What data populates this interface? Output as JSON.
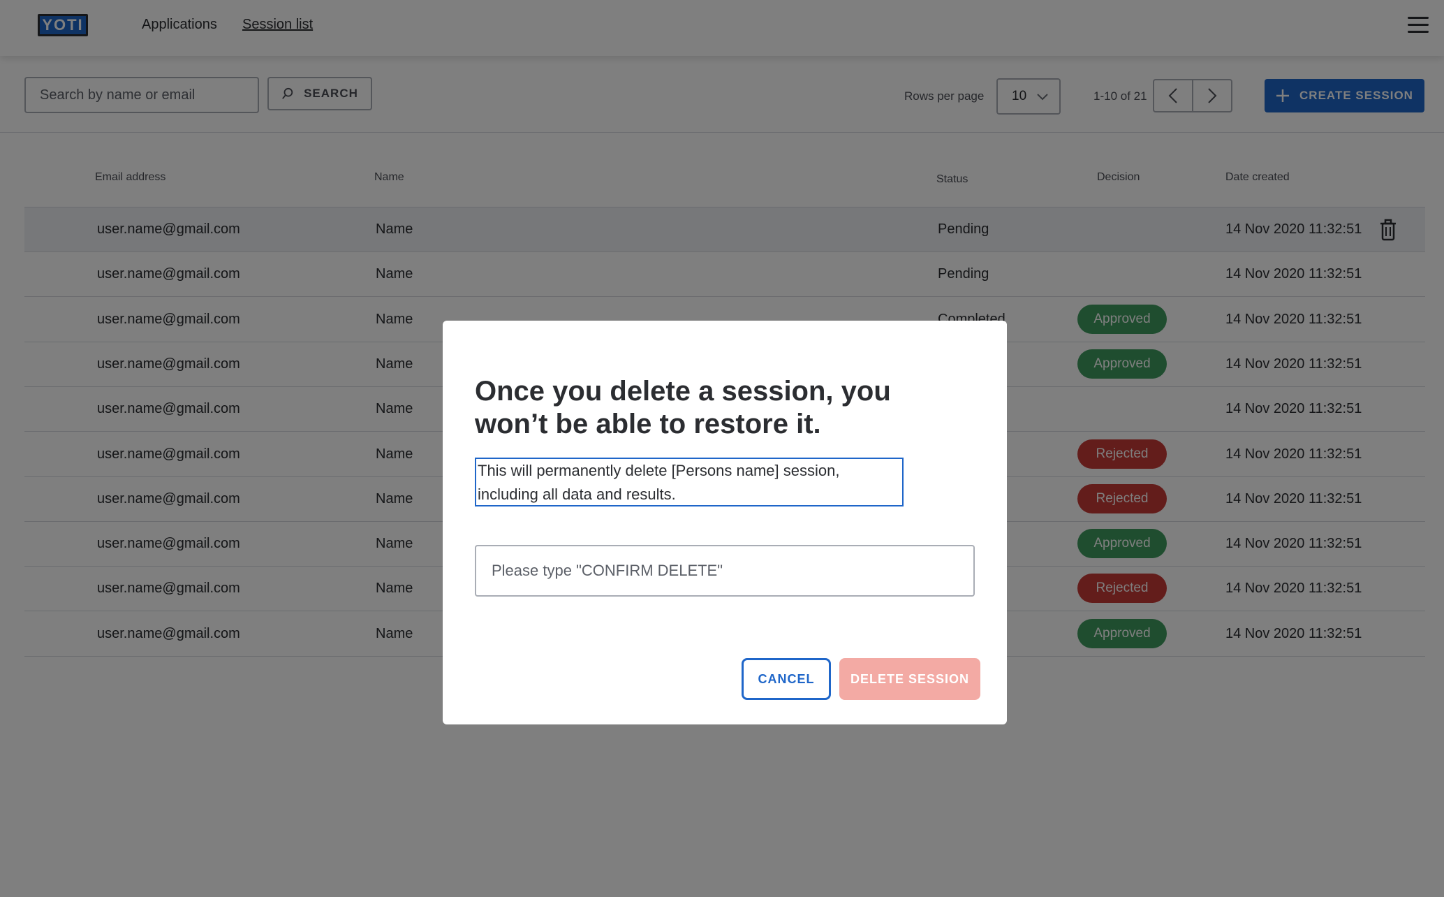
{
  "colors": {
    "brand": "#1f66c9",
    "approved": "#3f9b5e",
    "rejected": "#c73a36",
    "delete_disabled": "#f3aaa4"
  },
  "nav": {
    "logo_text": "YOTI",
    "links": [
      "Applications",
      "Session list"
    ],
    "menu_icon": "hamburger-icon"
  },
  "toolbar": {
    "search_placeholder": "Search by name or email",
    "search_label": "SEARCH",
    "rows_per_page_label": "Rows per page",
    "rows_per_page_value": "10",
    "pager_count": "1-10 of 21",
    "create_label": "CREATE SESSION"
  },
  "table": {
    "columns": [
      "Email address",
      "Name",
      "Status",
      "Decision",
      "Date created"
    ],
    "rows": [
      {
        "email": "user.name@gmail.com",
        "name": "Name",
        "status": "Pending",
        "decision": "",
        "date": "14 Nov 2020 11:32:51"
      },
      {
        "email": "user.name@gmail.com",
        "name": "Name",
        "status": "Pending",
        "decision": "",
        "date": "14 Nov 2020 11:32:51"
      },
      {
        "email": "user.name@gmail.com",
        "name": "Name",
        "status": "Completed",
        "decision": "Approved",
        "date": "14 Nov 2020 11:32:51"
      },
      {
        "email": "user.name@gmail.com",
        "name": "Name",
        "status": "",
        "decision": "Approved",
        "date": "14 Nov 2020 11:32:51"
      },
      {
        "email": "user.name@gmail.com",
        "name": "Name",
        "status": "",
        "decision": "",
        "date": "14 Nov 2020 11:32:51"
      },
      {
        "email": "user.name@gmail.com",
        "name": "Name",
        "status": "",
        "decision": "Rejected",
        "date": "14 Nov 2020 11:32:51"
      },
      {
        "email": "user.name@gmail.com",
        "name": "Name",
        "status": "",
        "decision": "Rejected",
        "date": "14 Nov 2020 11:32:51"
      },
      {
        "email": "user.name@gmail.com",
        "name": "Name",
        "status": "",
        "decision": "Approved",
        "date": "14 Nov 2020 11:32:51"
      },
      {
        "email": "user.name@gmail.com",
        "name": "Name",
        "status": "",
        "decision": "Rejected",
        "date": "14 Nov 2020 11:32:51"
      },
      {
        "email": "user.name@gmail.com",
        "name": "Name",
        "status": "",
        "decision": "Approved",
        "date": "14 Nov 2020 11:32:51"
      }
    ]
  },
  "modal": {
    "title": "Once you delete a session, you won’t be able to restore it.",
    "body": "This will permanently delete [Persons name] session, including all data and results.",
    "input_placeholder": "Please type \"CONFIRM DELETE\"",
    "cancel_label": "CANCEL",
    "delete_label": "DELETE SESSION"
  }
}
